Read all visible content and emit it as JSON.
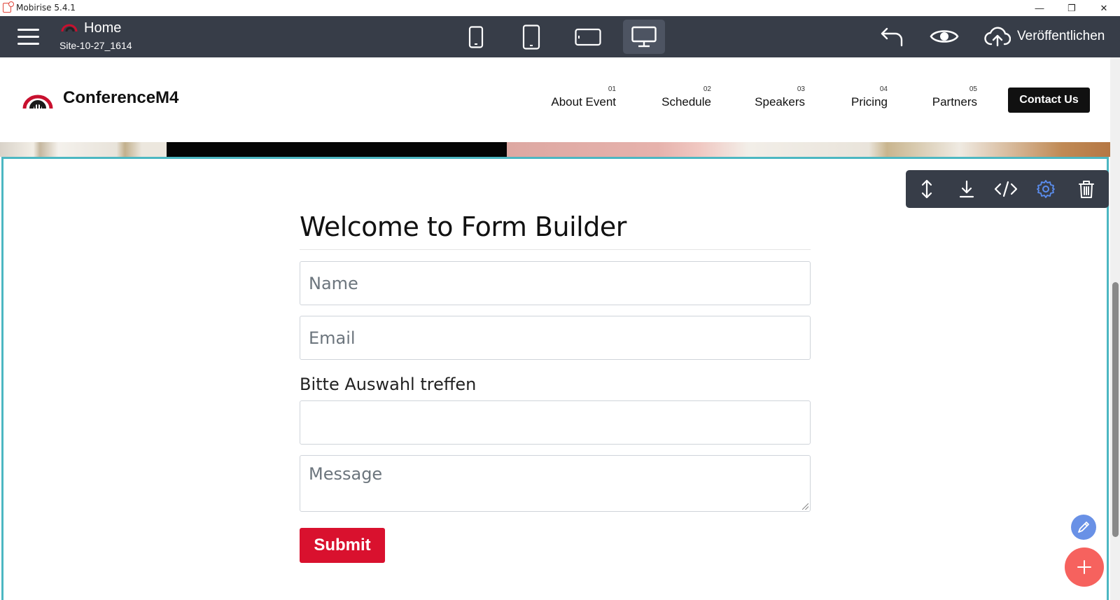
{
  "window": {
    "title": "Mobirise 5.4.1",
    "minimize_glyph": "—",
    "restore_glyph": "❐",
    "close_glyph": "✕"
  },
  "topbar": {
    "page_title": "Home",
    "site_name": "Site-10-27_1614",
    "devices": [
      {
        "name": "phone-portrait-icon",
        "active": false
      },
      {
        "name": "tablet-portrait-icon",
        "active": false
      },
      {
        "name": "tablet-landscape-icon",
        "active": false
      },
      {
        "name": "desktop-icon",
        "active": true
      }
    ],
    "publish_label": "Veröffentlichen"
  },
  "site_header": {
    "brand": "ConferenceM4",
    "nav": [
      {
        "num": "01",
        "label": "About Event"
      },
      {
        "num": "02",
        "label": "Schedule"
      },
      {
        "num": "03",
        "label": "Speakers"
      },
      {
        "num": "04",
        "label": "Pricing"
      },
      {
        "num": "05",
        "label": "Partners"
      }
    ],
    "contact_label": "Contact Us"
  },
  "block_toolbar": {
    "icons": [
      "move-icon",
      "download-icon",
      "code-icon",
      "gear-icon",
      "trash-icon"
    ]
  },
  "form": {
    "title": "Welcome to Form Builder",
    "name_placeholder": "Name",
    "email_placeholder": "Email",
    "select_label": "Bitte Auswahl treffen",
    "select_value": "",
    "message_placeholder": "Message",
    "submit_label": "Submit"
  },
  "colors": {
    "topbar_bg": "#373d48",
    "accent_red": "#d9112e",
    "section_border": "#4cb7c2",
    "gear_active": "#5b8ef0",
    "fab_edit": "#6991e6",
    "fab_add": "#f6625e"
  }
}
